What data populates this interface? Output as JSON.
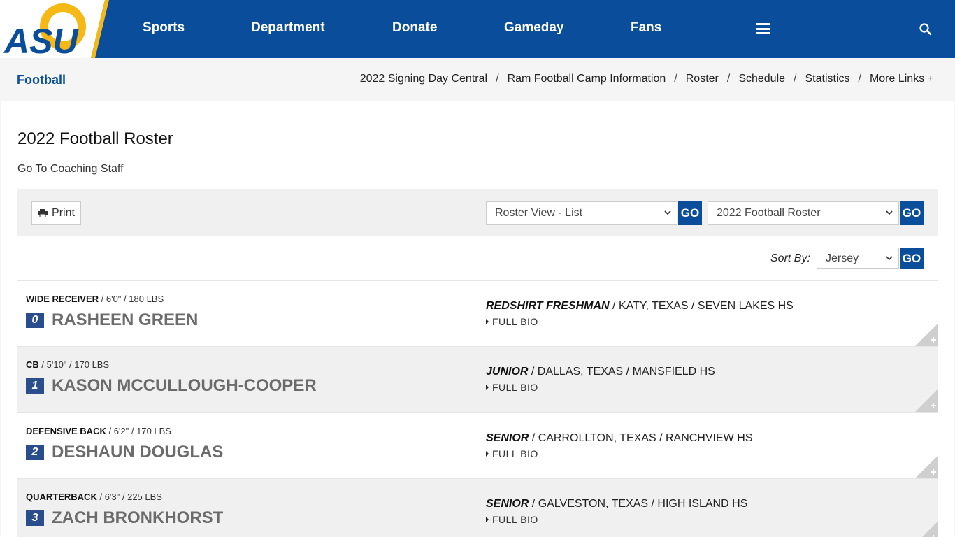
{
  "nav": {
    "logo_text": "ASU",
    "items": [
      "Sports",
      "Department",
      "Donate",
      "Gameday",
      "Fans"
    ],
    "menu_icon": "hamburger-icon",
    "search_icon": "search-icon"
  },
  "subnav": {
    "title": "Football",
    "links": [
      "2022 Signing Day Central",
      "Ram Football Camp Information",
      "Roster",
      "Schedule",
      "Statistics",
      "More Links +"
    ]
  },
  "page": {
    "title": "2022 Football Roster",
    "coach_link": "Go To Coaching Staff"
  },
  "toolbar": {
    "print_label": "Print",
    "view_select": "Roster View - List",
    "roster_select": "2022 Football Roster",
    "go_label": "GO"
  },
  "sort": {
    "label": "Sort By:",
    "value": "Jersey",
    "go_label": "GO"
  },
  "players": [
    {
      "position": "WIDE RECEIVER",
      "height": "6'0\"",
      "weight": "180 LBS",
      "number": "0",
      "name": "RASHEEN GREEN",
      "class": "REDSHIRT FRESHMAN",
      "hometown": "KATY, TEXAS",
      "school": "SEVEN LAKES HS",
      "bio": "FULL BIO"
    },
    {
      "position": "CB",
      "height": "5'10\"",
      "weight": "170 LBS",
      "number": "1",
      "name": "KASON MCCULLOUGH-COOPER",
      "class": "JUNIOR",
      "hometown": "DALLAS, TEXAS",
      "school": "MANSFIELD HS",
      "bio": "FULL BIO"
    },
    {
      "position": "DEFENSIVE BACK",
      "height": "6'2\"",
      "weight": "170 LBS",
      "number": "2",
      "name": "DESHAUN DOUGLAS",
      "class": "SENIOR",
      "hometown": "CARROLLTON, TEXAS",
      "school": "RANCHVIEW HS",
      "bio": "FULL BIO"
    },
    {
      "position": "QUARTERBACK",
      "height": "6'3\"",
      "weight": "225 LBS",
      "number": "3",
      "name": "ZACH BRONKHORST",
      "class": "SENIOR",
      "hometown": "GALVESTON, TEXAS",
      "school": "HIGH ISLAND HS",
      "bio": "FULL BIO"
    }
  ],
  "colors": {
    "brand_blue": "#0a4e9b",
    "brand_gold": "#f5b814",
    "badge_blue": "#2a4d8e"
  }
}
